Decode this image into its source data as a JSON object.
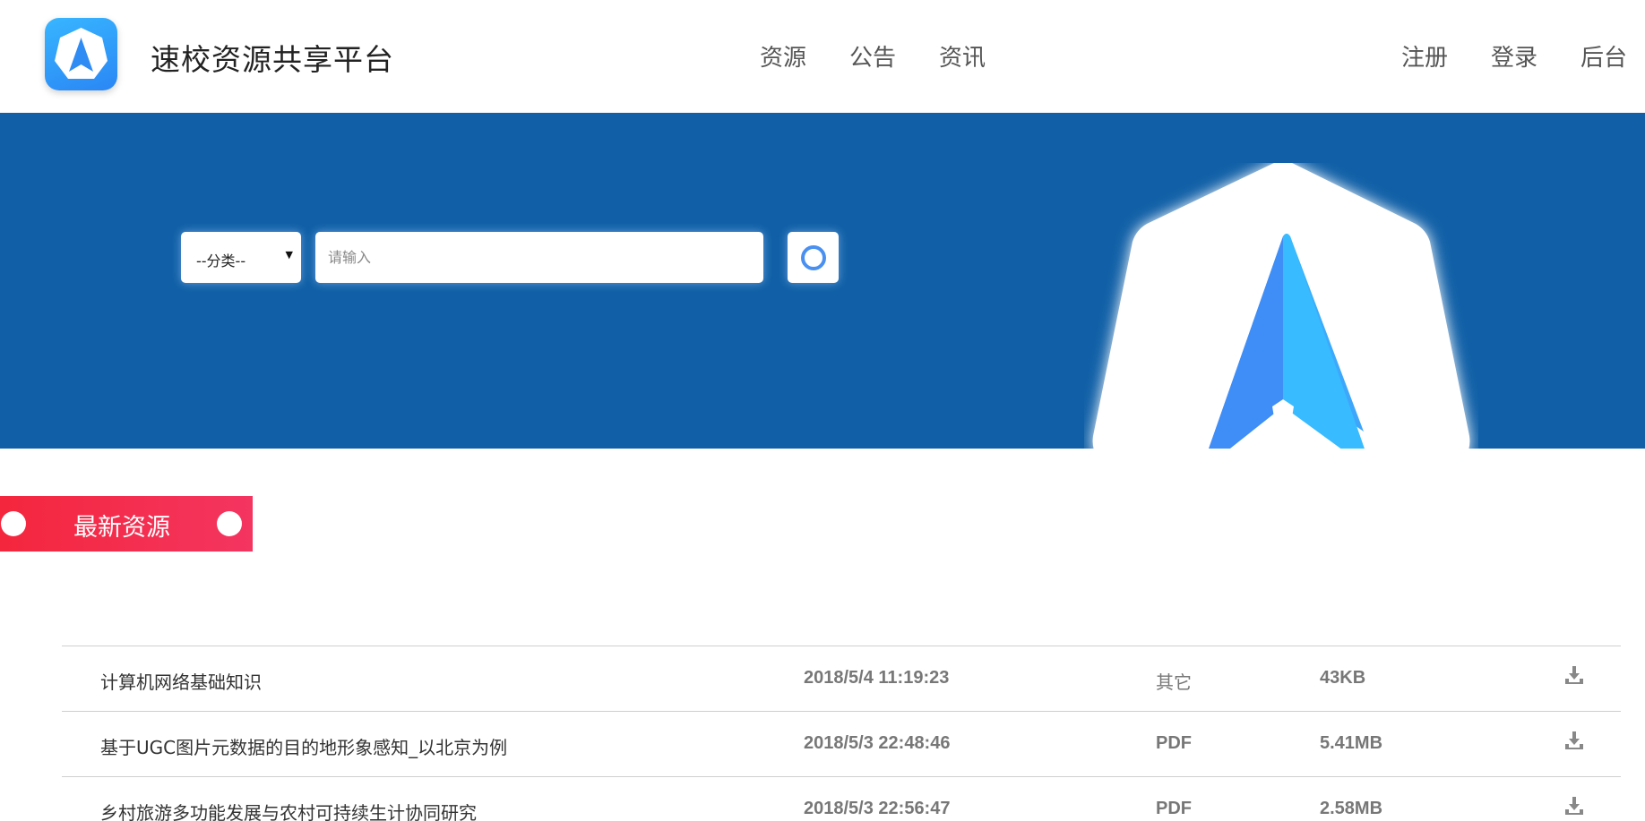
{
  "header": {
    "site_title": "速校资源共享平台",
    "nav_center": [
      "资源",
      "公告",
      "资讯"
    ],
    "nav_right": [
      "注册",
      "登录",
      "后台"
    ]
  },
  "search": {
    "category_label": "--分类--",
    "input_placeholder": "请输入"
  },
  "section": {
    "title": "最新资源"
  },
  "resources": [
    {
      "name": "计算机网络基础知识",
      "time": "2018/5/4 11:19:23",
      "type": "其它",
      "size": "43KB"
    },
    {
      "name": "基于UGC图片元数据的目的地形象感知_以北京为例",
      "time": "2018/5/3 22:48:46",
      "type": "PDF",
      "size": "5.41MB"
    },
    {
      "name": "乡村旅游多功能发展与农村可持续生计协同研究",
      "time": "2018/5/3 22:56:47",
      "type": "PDF",
      "size": "2.58MB"
    }
  ],
  "icons": {
    "logo": "navigation-arrow-icon",
    "search": "search-ring-icon",
    "download": "download-icon"
  },
  "colors": {
    "banner": "#1160a7",
    "tab_start": "#f4263d",
    "tab_end": "#f43560",
    "logo_gradient_start": "#38b6ff",
    "logo_gradient_end": "#2a86f5"
  }
}
